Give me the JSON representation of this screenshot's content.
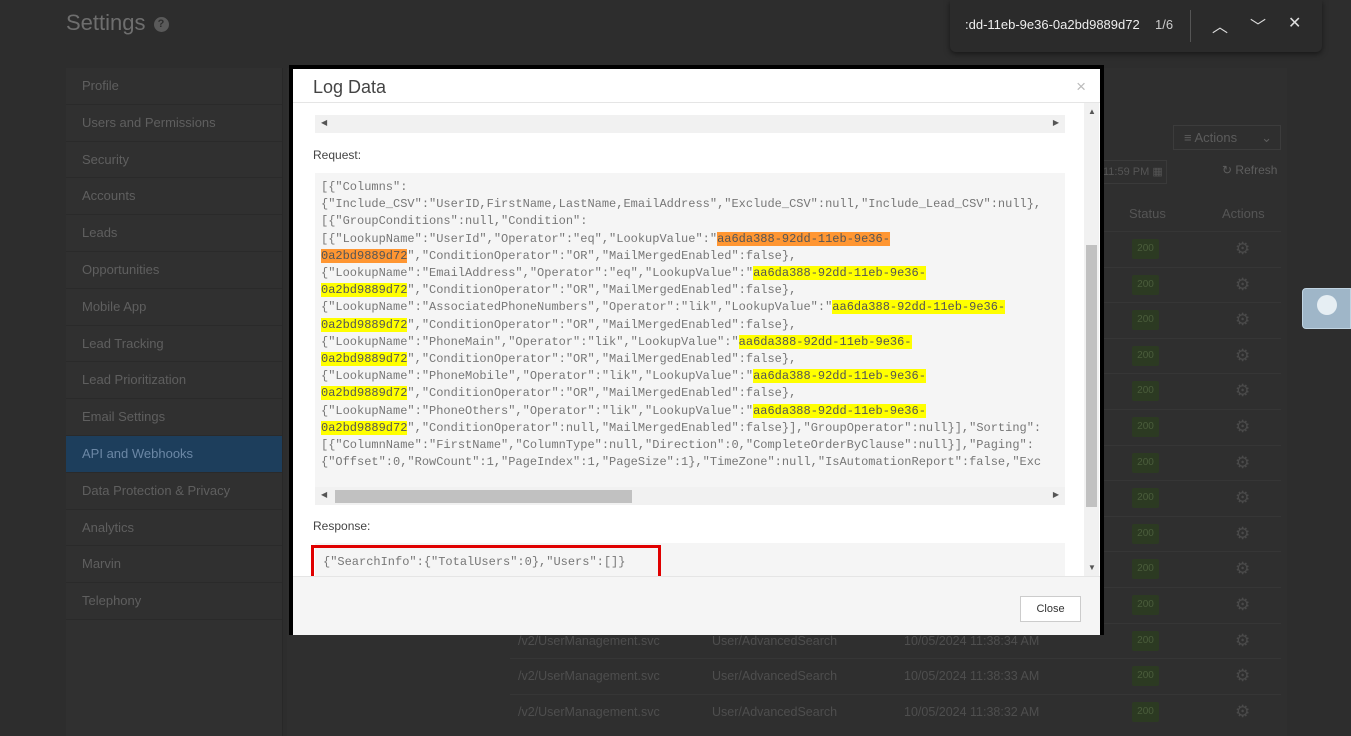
{
  "page": {
    "title": "Settings"
  },
  "sidebar": {
    "items": [
      "Profile",
      "Users and Permissions",
      "Security",
      "Accounts",
      "Leads",
      "Opportunities",
      "Mobile App",
      "Lead Tracking",
      "Lead Prioritization",
      "Email Settings",
      "API and Webhooks",
      "Data Protection & Privacy",
      "Analytics",
      "Marvin",
      "Telephony"
    ],
    "active": "API and Webhooks"
  },
  "toolbar": {
    "actions_label": "Actions",
    "date_value": "11:59 PM",
    "refresh_label": "Refresh"
  },
  "table": {
    "headers": {
      "status": "Status",
      "actions": "Actions"
    },
    "rows": [
      {
        "url": "",
        "method": "",
        "time": "",
        "status": "200"
      },
      {
        "url": "",
        "method": "",
        "time": "",
        "status": "200"
      },
      {
        "url": "",
        "method": "",
        "time": "",
        "status": "200"
      },
      {
        "url": "",
        "method": "",
        "time": "",
        "status": "200"
      },
      {
        "url": "",
        "method": "",
        "time": "",
        "status": "200"
      },
      {
        "url": "",
        "method": "",
        "time": "",
        "status": "200"
      },
      {
        "url": "",
        "method": "",
        "time": "",
        "status": "200"
      },
      {
        "url": "",
        "method": "",
        "time": "",
        "status": "200"
      },
      {
        "url": "",
        "method": "",
        "time": "",
        "status": "200"
      },
      {
        "url": "",
        "method": "",
        "time": "",
        "status": "200"
      },
      {
        "url": "",
        "method": "",
        "time": "",
        "status": "200"
      },
      {
        "url": "/v2/UserManagement.svc",
        "method": "User/AdvancedSearch",
        "time": "10/05/2024 11:38:34 AM",
        "status": "200"
      },
      {
        "url": "/v2/UserManagement.svc",
        "method": "User/AdvancedSearch",
        "time": "10/05/2024 11:38:33 AM",
        "status": "200"
      },
      {
        "url": "/v2/UserManagement.svc",
        "method": "User/AdvancedSearch",
        "time": "10/05/2024 11:38:32 AM",
        "status": "200"
      }
    ]
  },
  "find": {
    "query": ":dd-11eb-9e36-0a2bd9889d72",
    "count": "1/6"
  },
  "modal": {
    "title": "Log Data",
    "request_label": "Request:",
    "response_label": "Response:",
    "close_label": "Close",
    "request_lines": [
      {
        "t": "[{\"Columns\":"
      },
      {
        "t": "{\"Include_CSV\":\"UserID,FirstName,LastName,EmailAddress\",\"Exclude_CSV\":null,\"Include_Lead_CSV\":null},"
      },
      {
        "t": "[{\"GroupConditions\":null,\"Condition\":"
      },
      {
        "t": "[{\"LookupName\":\"UserId\",\"Operator\":\"eq\",\"LookupValue\":\"",
        "h": "aa6da388-92dd-11eb-9e36-",
        "cur": true
      },
      {
        "h": "0a2bd9889d72",
        "cur": true,
        "a": "\",\"ConditionOperator\":\"OR\",\"MailMergedEnabled\":false},"
      },
      {
        "t": "{\"LookupName\":\"EmailAddress\",\"Operator\":\"eq\",\"LookupValue\":\"",
        "h": "aa6da388-92dd-11eb-9e36-"
      },
      {
        "h": "0a2bd9889d72",
        "a": "\",\"ConditionOperator\":\"OR\",\"MailMergedEnabled\":false},"
      },
      {
        "t": "{\"LookupName\":\"AssociatedPhoneNumbers\",\"Operator\":\"lik\",\"LookupValue\":\"",
        "h": "aa6da388-92dd-11eb-9e36-"
      },
      {
        "h": "0a2bd9889d72",
        "a": "\",\"ConditionOperator\":\"OR\",\"MailMergedEnabled\":false},"
      },
      {
        "t": "{\"LookupName\":\"PhoneMain\",\"Operator\":\"lik\",\"LookupValue\":\"",
        "h": "aa6da388-92dd-11eb-9e36-"
      },
      {
        "h": "0a2bd9889d72",
        "a": "\",\"ConditionOperator\":\"OR\",\"MailMergedEnabled\":false},"
      },
      {
        "t": "{\"LookupName\":\"PhoneMobile\",\"Operator\":\"lik\",\"LookupValue\":\"",
        "h": "aa6da388-92dd-11eb-9e36-"
      },
      {
        "h": "0a2bd9889d72",
        "a": "\",\"ConditionOperator\":\"OR\",\"MailMergedEnabled\":false},"
      },
      {
        "t": "{\"LookupName\":\"PhoneOthers\",\"Operator\":\"lik\",\"LookupValue\":\"",
        "h": "aa6da388-92dd-11eb-9e36-"
      },
      {
        "h": "0a2bd9889d72",
        "a": "\",\"ConditionOperator\":null,\"MailMergedEnabled\":false}],\"GroupOperator\":null}],\"Sorting\":"
      },
      {
        "t": "[{\"ColumnName\":\"FirstName\",\"ColumnType\":null,\"Direction\":0,\"CompleteOrderByClause\":null}],\"Paging\":"
      },
      {
        "t": "{\"Offset\":0,\"RowCount\":1,\"PageIndex\":1,\"PageSize\":1},\"TimeZone\":null,\"IsAutomationReport\":false,\"Exc"
      }
    ],
    "response_text": "{\"SearchInfo\":{\"TotalUsers\":0},\"Users\":[]}"
  }
}
